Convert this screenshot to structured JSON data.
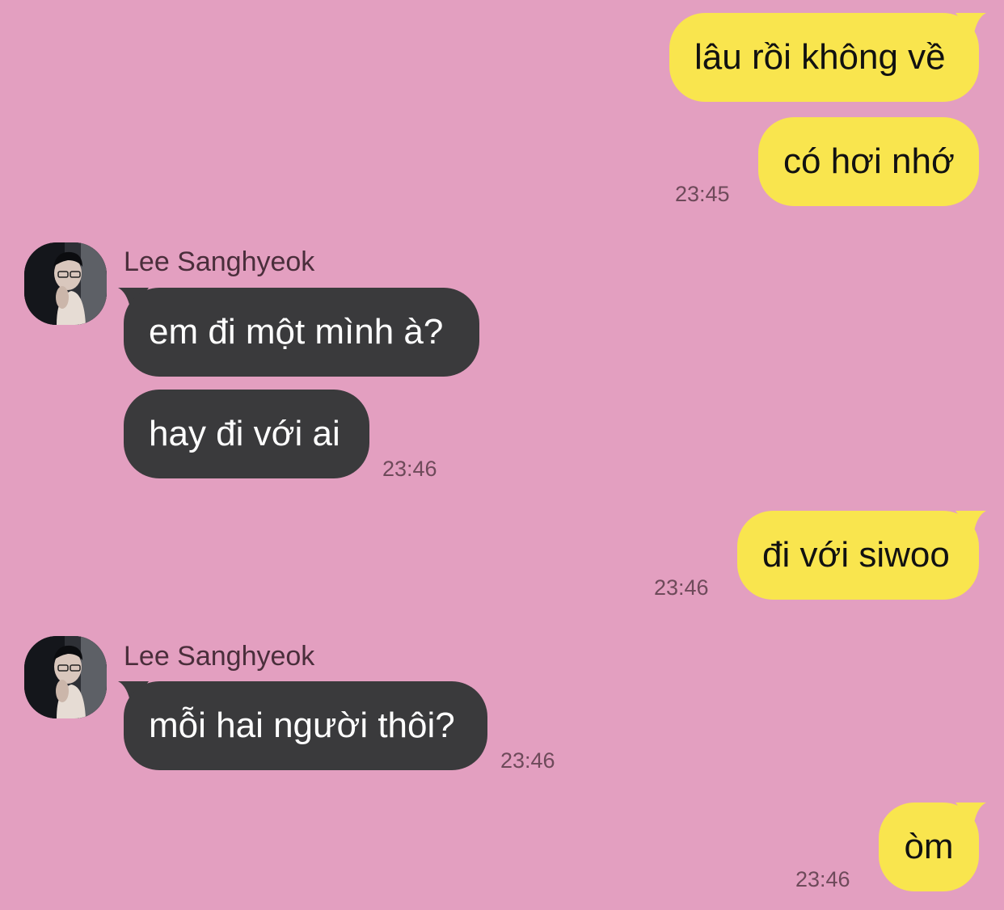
{
  "colors": {
    "background": "#e39fc0",
    "outgoing_bubble": "#f9e54e",
    "incoming_bubble": "#3a3a3c"
  },
  "messages": {
    "m1": "lâu rồi không về",
    "m2": "có hơi nhớ",
    "m2_time": "23:45",
    "sender_1": "Lee Sanghyeok",
    "m3": "em đi một mình à?",
    "m4": "hay đi với ai",
    "m4_time": "23:46",
    "m5": "đi với siwoo",
    "m5_time": "23:46",
    "sender_2": "Lee Sanghyeok",
    "m6": "mỗi hai người thôi?",
    "m6_time": "23:46",
    "m7": "òm",
    "m7_time": "23:46"
  },
  "icons": {
    "avatar": "profile-photo"
  }
}
